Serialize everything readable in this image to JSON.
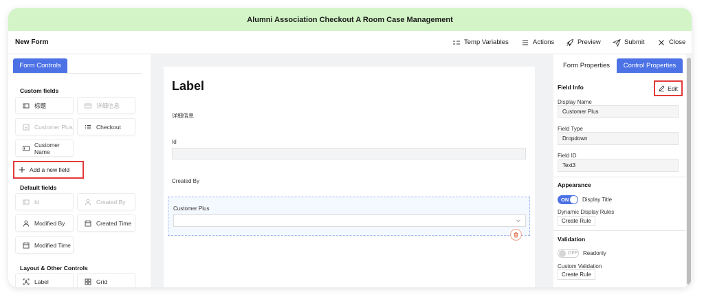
{
  "app": {
    "title": "Alumni Association Checkout A Room Case Management"
  },
  "header": {
    "form_title": "New Form",
    "actions": [
      {
        "label": "Temp Variables",
        "icon": "variables-icon"
      },
      {
        "label": "Actions",
        "icon": "list-icon"
      },
      {
        "label": "Preview",
        "icon": "rocket-icon"
      },
      {
        "label": "Submit",
        "icon": "send-icon"
      },
      {
        "label": "Close",
        "icon": "close-icon"
      }
    ]
  },
  "left_panel": {
    "tab": "Form Controls",
    "custom_fields_title": "Custom fields",
    "custom_fields": [
      {
        "label": "标题",
        "icon": "rectangle-icon",
        "disabled": false
      },
      {
        "label": "详细信息",
        "icon": "card-icon",
        "disabled": true
      },
      {
        "label": "Customer Plus",
        "icon": "dropdown-icon",
        "disabled": true
      },
      {
        "label": "Checkout",
        "icon": "list-icon",
        "disabled": false
      },
      {
        "label": "Customer Name",
        "icon": "textbox-icon",
        "disabled": false
      }
    ],
    "add_field": "Add a new field",
    "default_fields_title": "Default fields",
    "default_fields": [
      {
        "label": "Id",
        "icon": "rectangle-icon",
        "disabled": true
      },
      {
        "label": "Created By",
        "icon": "user-icon",
        "disabled": true
      },
      {
        "label": "Modified By",
        "icon": "user-icon",
        "disabled": false
      },
      {
        "label": "Created Time",
        "icon": "calendar-icon",
        "disabled": false
      },
      {
        "label": "Modified Time",
        "icon": "calendar-icon",
        "disabled": false
      }
    ],
    "layout_title": "Layout & Other Controls",
    "layout_controls": [
      {
        "label": "Label",
        "icon": "text-label-icon"
      },
      {
        "label": "Grid",
        "icon": "grid-icon"
      }
    ]
  },
  "canvas": {
    "label_heading": "Label",
    "detail_text": "详细信息",
    "field_id_label": "Id",
    "created_by_label": "Created By",
    "selected_field_label": "Customer Plus",
    "selected_field_value": ""
  },
  "right_panel": {
    "tabs": [
      "Form Properties",
      "Control Properties"
    ],
    "field_info_title": "Field Info",
    "edit_label": "Edit",
    "display_name_label": "Display Name",
    "display_name_value": "Customer Plus",
    "field_type_label": "Field Type",
    "field_type_value": "Dropdown",
    "field_id_label": "Field ID",
    "field_id_value": "Text3",
    "appearance_title": "Appearance",
    "display_title_toggle": "ON",
    "display_title_label": "Display Title",
    "dynamic_rules_label": "Dynamic Display Rules",
    "create_rule_label": "Create Rule",
    "validation_title": "Validation",
    "readonly_toggle": "OFF",
    "readonly_label": "Readonly",
    "custom_validation_label": "Custom Validation",
    "create_rule_label_2": "Create Rule"
  },
  "colors": {
    "banner": "#d2f4c6",
    "accent": "#4c72e6",
    "highlight": "#e33a3a"
  }
}
